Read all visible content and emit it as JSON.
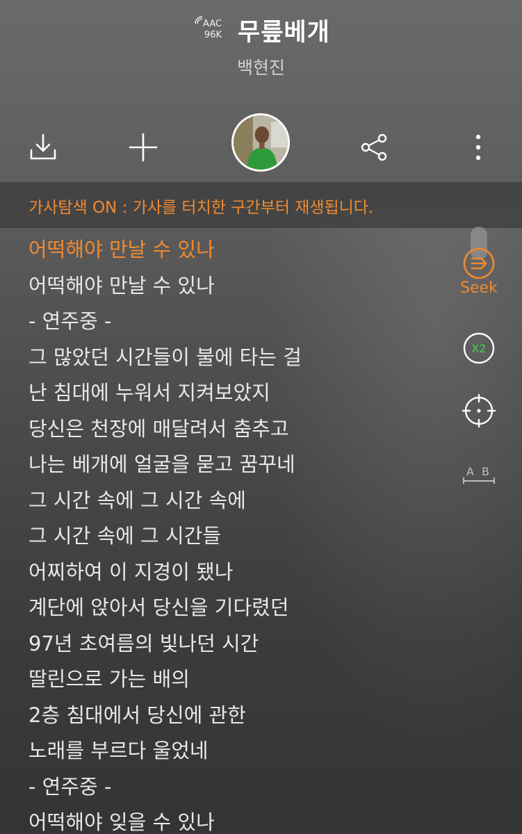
{
  "header": {
    "codec_top": "AAC",
    "codec_bottom": "96K",
    "title": "무릎베개",
    "artist": "백현진"
  },
  "toolbar": {
    "download_icon": "download-icon",
    "add_icon": "plus-icon",
    "share_icon": "share-icon",
    "more_icon": "more-vertical-icon"
  },
  "banner": {
    "text": "가사탐색 ON : 가사를 터치한 구간부터 재생됩니다."
  },
  "lyrics": [
    "어떡해야 만날 수 있나",
    "어떡해야 만날 수 있나",
    "- 연주중 -",
    "그 많았던 시간들이 불에 타는 걸",
    "난 침대에 누워서 지켜보았지",
    "당신은 천장에 매달려서 춤추고",
    "나는 베개에 얼굴을 묻고 꿈꾸네",
    "그 시간 속에 그 시간 속에",
    "그 시간 속에 그 시간들",
    "어찌하여 이 지경이 됐나",
    "계단에 앉아서 당신을 기다렸던",
    "97년 초여름의 빛나던 시간",
    "딸린으로 가는 배의",
    "2층 침대에서 당신에 관한",
    "노래를 부르다 울었네",
    "- 연주중 -",
    "어떡해야 잊을 수 있나"
  ],
  "current_line_index": 0,
  "side_controls": {
    "seek_label": "Seek",
    "speed_label": "X2",
    "ab_label": "A B"
  },
  "colors": {
    "accent": "#f08a30",
    "speed_green": "#3fd84a"
  }
}
